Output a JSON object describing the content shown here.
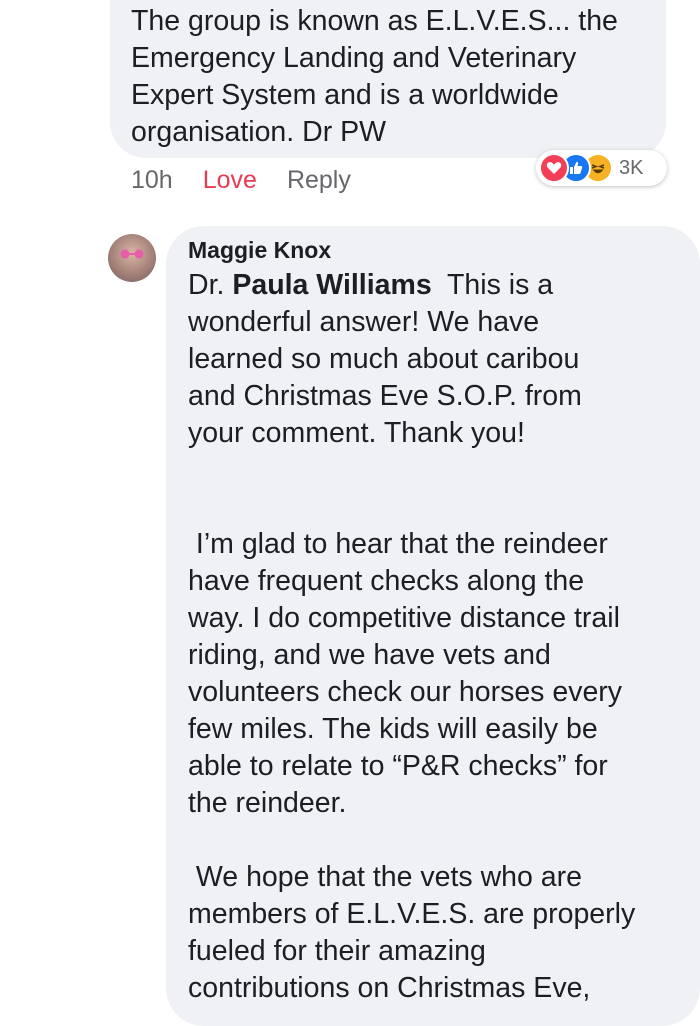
{
  "comment1": {
    "text_lines": [
      "The group is known as  E.L.V.E.S... the",
      "Emergency Landing and Veterinary",
      "Expert System and is a worldwide",
      "organisation. Dr PW"
    ],
    "time": "10h",
    "love_label": "Love",
    "reply_label": "Reply",
    "reaction_count": "3K",
    "reaction_icons": [
      "heart-icon",
      "like-icon",
      "haha-icon"
    ],
    "love_color": "#e73b52"
  },
  "comment2": {
    "author": "Maggie Knox",
    "mention_prefix": "Dr. ",
    "mention_name": "Paula Williams",
    "para1_first": "  This is a",
    "para1_lines": [
      "wonderful answer! We have",
      "learned so much about caribou",
      "and Christmas Eve S.O.P. from",
      "your comment. Thank you!"
    ],
    "para2_lines": [
      " I’m glad to hear that the reindeer",
      "have frequent checks along the",
      "way. I do competitive distance trail",
      "riding, and we have vets and",
      "volunteers check our horses every",
      "few miles. The kids will easily be",
      "able to relate to “P&R checks” for",
      "the reindeer."
    ],
    "para3_lines": [
      " We hope that the vets who are",
      "members of E.L.V.E.S. are properly",
      "fueled for their amazing",
      "contributions on Christmas Eve,"
    ]
  }
}
